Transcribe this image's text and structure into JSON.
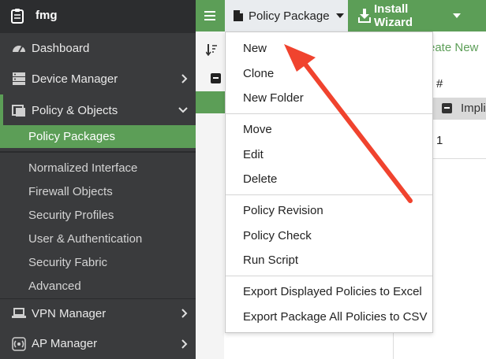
{
  "sidebar": {
    "app_name": "fmg",
    "items": [
      {
        "label": "Dashboard"
      },
      {
        "label": "Device Manager"
      },
      {
        "label": "Policy & Objects"
      },
      {
        "label": "Policy Packages"
      },
      {
        "label": "Normalized Interface"
      },
      {
        "label": "Firewall Objects"
      },
      {
        "label": "Security Profiles"
      },
      {
        "label": "User & Authentication"
      },
      {
        "label": "Security Fabric"
      },
      {
        "label": "Advanced"
      },
      {
        "label": "VPN Manager"
      },
      {
        "label": "AP Manager"
      }
    ]
  },
  "topbar": {
    "policy_package_label": "Policy Package",
    "install_wizard_label": "Install Wizard"
  },
  "main": {
    "create_new_label": "reate New",
    "column_hash": "#",
    "implied_label": "Impli",
    "row_number": "1"
  },
  "dropdown": {
    "items": [
      {
        "label": "New"
      },
      {
        "label": "Clone"
      },
      {
        "label": "New Folder"
      },
      {
        "label": "Move"
      },
      {
        "label": "Edit"
      },
      {
        "label": "Delete"
      },
      {
        "label": "Policy Revision"
      },
      {
        "label": "Policy Check"
      },
      {
        "label": "Run Script"
      },
      {
        "label": "Export Displayed Policies to Excel"
      },
      {
        "label": "Export Package All Policies to CSV"
      }
    ]
  },
  "colors": {
    "accent_green": "#5c9e57",
    "sidebar_bg": "#3a3b3d",
    "annotation_arrow": "#f0432e"
  }
}
